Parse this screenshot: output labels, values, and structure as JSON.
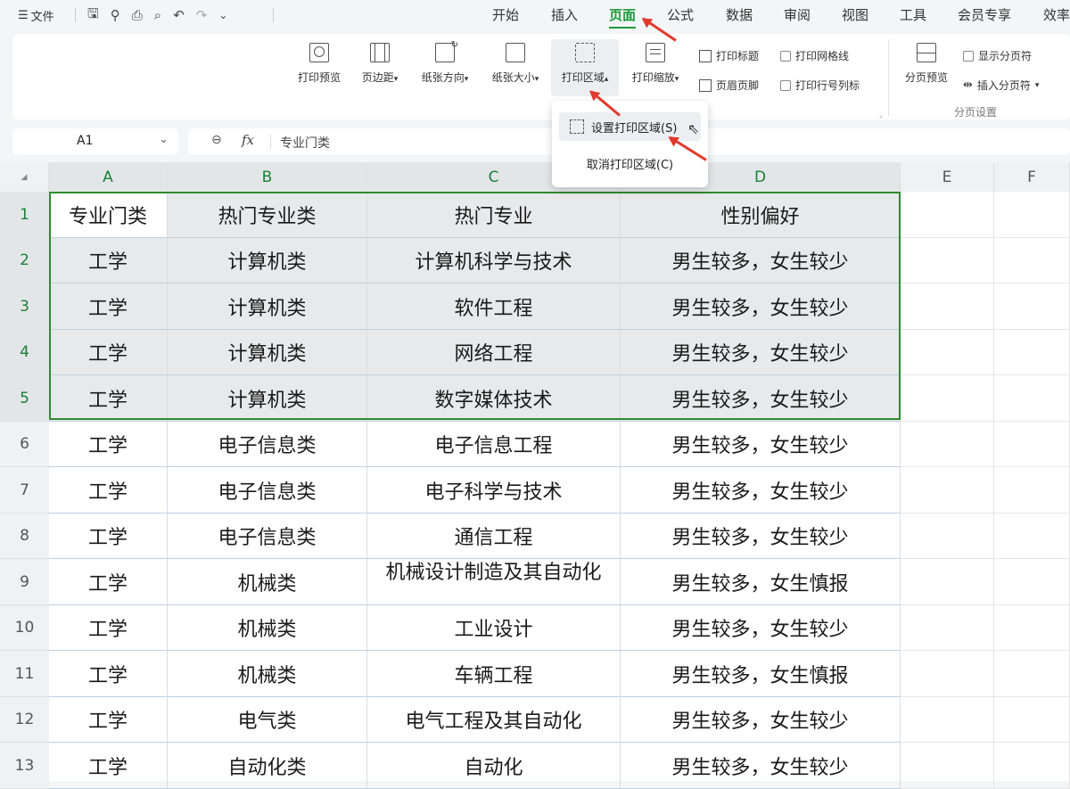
{
  "quick_access": {
    "menu_icon": "hamburger-icon",
    "file_label": "文件",
    "icons": [
      "save-icon",
      "link-icon",
      "print-icon",
      "print-preview-icon",
      "undo-icon",
      "redo-icon",
      "chevron-down-icon"
    ]
  },
  "menu_tabs": [
    "开始",
    "插入",
    "页面",
    "公式",
    "数据",
    "审阅",
    "视图",
    "工具",
    "会员专享",
    "效率"
  ],
  "active_tab": "页面",
  "ribbon": {
    "print_preview": "打印预览",
    "margins": "页边距",
    "orientation": "纸张方向",
    "paper_size": "纸张大小",
    "print_area": "打印区域",
    "print_scale": "打印缩放",
    "print_titles": "打印标题",
    "header_footer": "页眉页脚",
    "print_gridlines": "打印网格线",
    "print_row_col_headers": "打印行号列标",
    "page_break_preview": "分页预览",
    "show_page_breaks": "显示分页符",
    "insert_page_break": "插入分页符",
    "group_page_break": "分页设置"
  },
  "formula_bar": {
    "cell_ref": "A1",
    "fx_label": "fx",
    "content": "专业门类"
  },
  "dropdown": {
    "set_print_area": "设置打印区域(S)",
    "clear_print_area": "取消打印区域(C)"
  },
  "columns": [
    "A",
    "B",
    "C",
    "D",
    "E",
    "F"
  ],
  "rows": [
    {
      "num": "1",
      "cells": [
        "专业门类",
        "热门专业类",
        "热门专业",
        "性别偏好"
      ]
    },
    {
      "num": "2",
      "cells": [
        "工学",
        "计算机类",
        "计算机科学与技术",
        "男生较多，女生较少"
      ]
    },
    {
      "num": "3",
      "cells": [
        "工学",
        "计算机类",
        "软件工程",
        "男生较多，女生较少"
      ]
    },
    {
      "num": "4",
      "cells": [
        "工学",
        "计算机类",
        "网络工程",
        "男生较多，女生较少"
      ]
    },
    {
      "num": "5",
      "cells": [
        "工学",
        "计算机类",
        "数字媒体技术",
        "男生较多，女生较少"
      ]
    },
    {
      "num": "6",
      "cells": [
        "工学",
        "电子信息类",
        "电子信息工程",
        "男生较多，女生较少"
      ]
    },
    {
      "num": "7",
      "cells": [
        "工学",
        "电子信息类",
        "电子科学与技术",
        "男生较多，女生较少"
      ]
    },
    {
      "num": "8",
      "cells": [
        "工学",
        "电子信息类",
        "通信工程",
        "男生较多，女生较少"
      ]
    },
    {
      "num": "9",
      "cells": [
        "工学",
        "机械类",
        "机械设计制造及其自动化",
        "男生较多，女生慎报"
      ]
    },
    {
      "num": "10",
      "cells": [
        "工学",
        "机械类",
        "工业设计",
        "男生较多，女生较少"
      ]
    },
    {
      "num": "11",
      "cells": [
        "工学",
        "机械类",
        "车辆工程",
        "男生较多，女生慎报"
      ]
    },
    {
      "num": "12",
      "cells": [
        "工学",
        "电气类",
        "电气工程及其自动化",
        "男生较多，女生较少"
      ]
    },
    {
      "num": "13",
      "cells": [
        "工学",
        "自动化类",
        "自动化",
        "男生较多，女生较少"
      ]
    }
  ],
  "selected_range": "A1:D5",
  "colors": {
    "accent": "#1a9a3c",
    "print_area_border": "#2e8b2e",
    "annotation_arrow": "#e03a2e"
  }
}
